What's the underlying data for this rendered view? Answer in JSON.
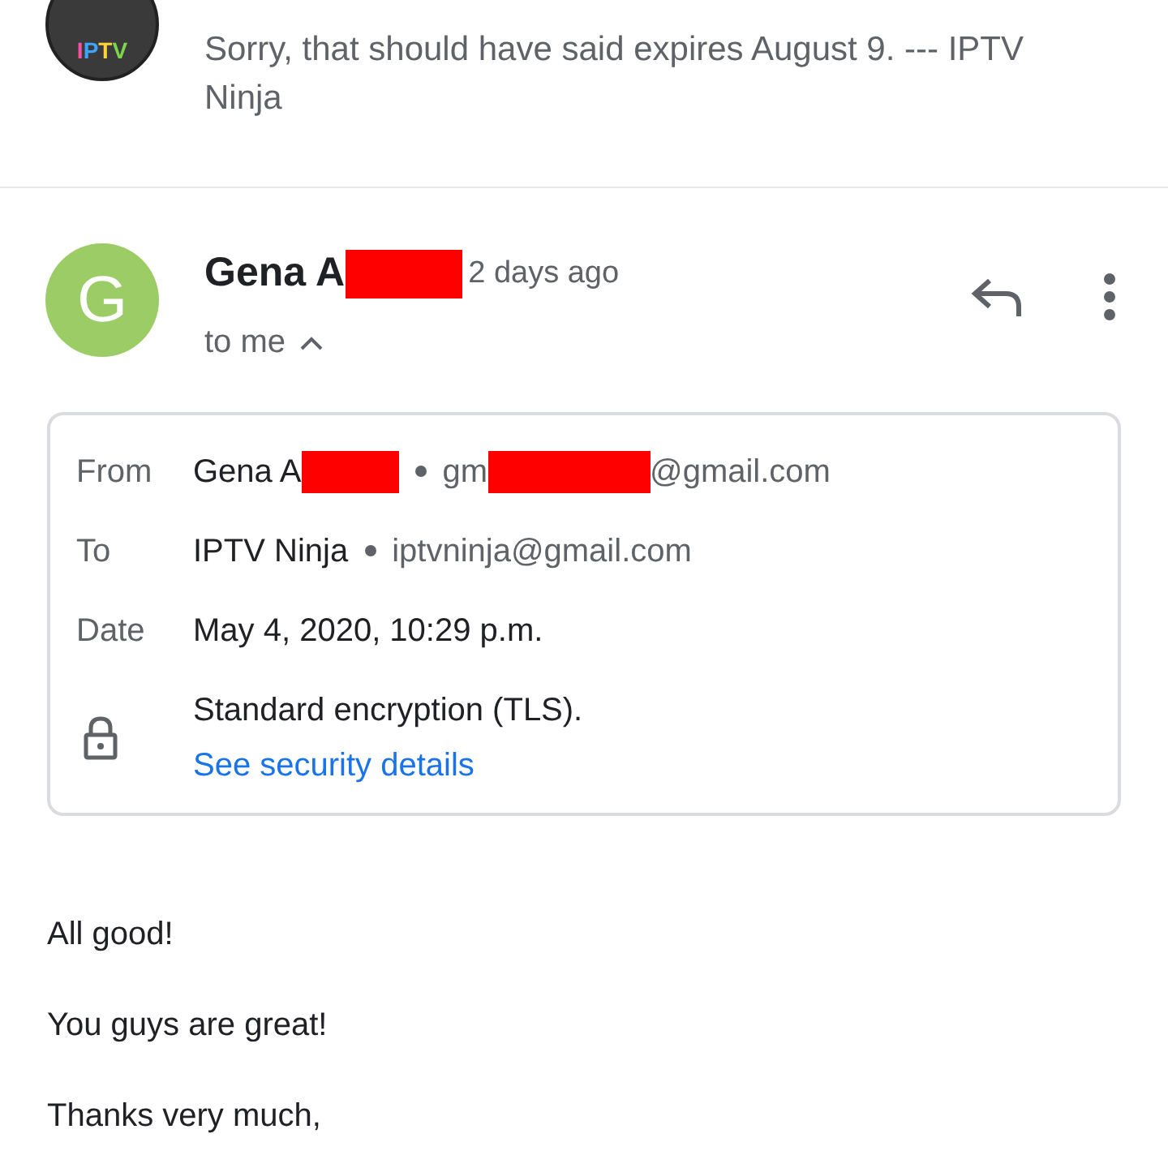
{
  "previous_message": {
    "avatar_text": "IPTV",
    "snippet": "Sorry, that should have said expires August 9. --- IPTV Ninja"
  },
  "message": {
    "avatar_letter": "G",
    "sender": "Gena A",
    "sender_redacted": true,
    "time": "2 days ago",
    "recipient_line": "to me",
    "details_expanded": true,
    "details": {
      "from_label": "From",
      "from_name": "Gena A",
      "from_name_redacted": true,
      "from_email_start": "gm",
      "from_email_redacted": true,
      "from_email_end": "@gmail.com",
      "to_label": "To",
      "to_name": "IPTV Ninja",
      "to_email": "iptvninja@gmail.com",
      "date_label": "Date",
      "date": "May 4, 2020, 10:29 p.m.",
      "encryption": "Standard encryption (TLS).",
      "security_link": "See security details"
    },
    "body": [
      "All good!",
      "You guys are great!",
      "Thanks very much,"
    ]
  }
}
